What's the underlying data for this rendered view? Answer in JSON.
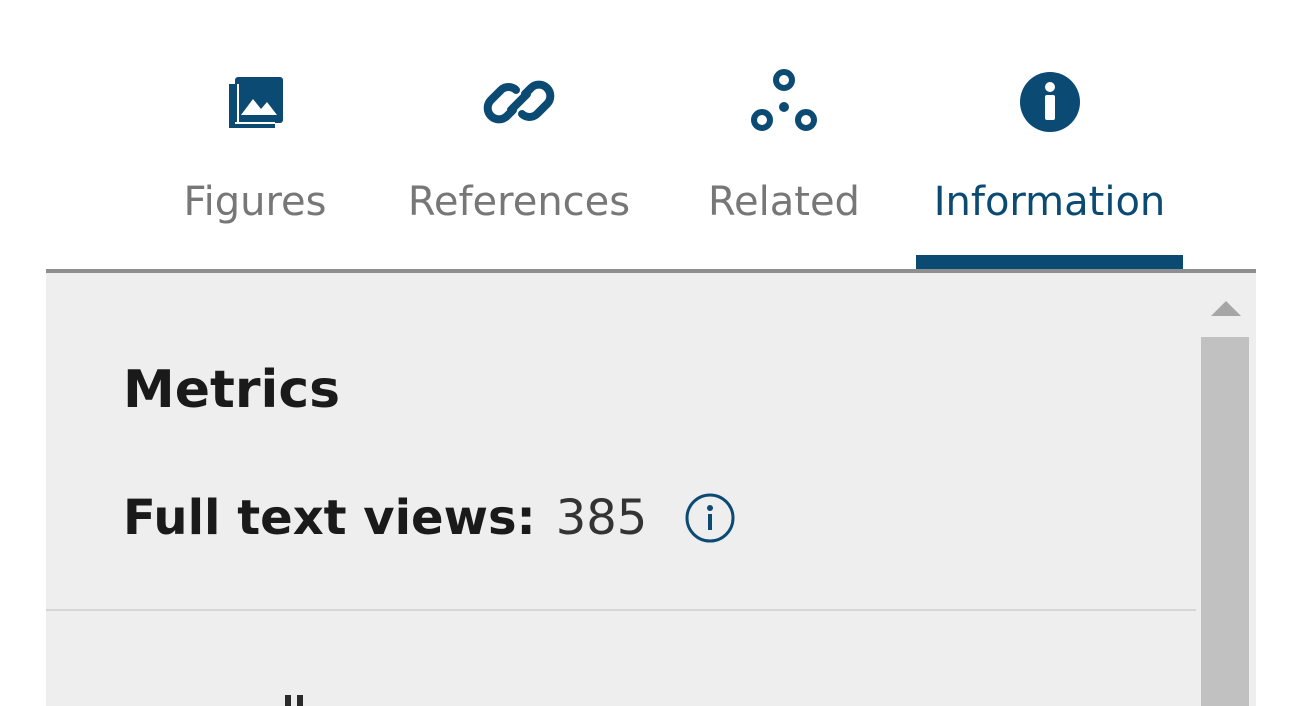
{
  "tabs": [
    {
      "label": "Figures",
      "icon": "image-gallery-icon",
      "active": false
    },
    {
      "label": "References",
      "icon": "link-icon",
      "active": false
    },
    {
      "label": "Related",
      "icon": "related-nodes-icon",
      "active": false
    },
    {
      "label": "Information",
      "icon": "info-circle-icon",
      "active": true
    }
  ],
  "panel": {
    "metrics": {
      "title": "Metrics",
      "full_text_views_label": "Full text views:",
      "full_text_views_value": "385"
    }
  },
  "colors": {
    "accent": "#0a4a73",
    "tab_inactive_text": "#777777",
    "panel_background": "#eeeeee"
  }
}
